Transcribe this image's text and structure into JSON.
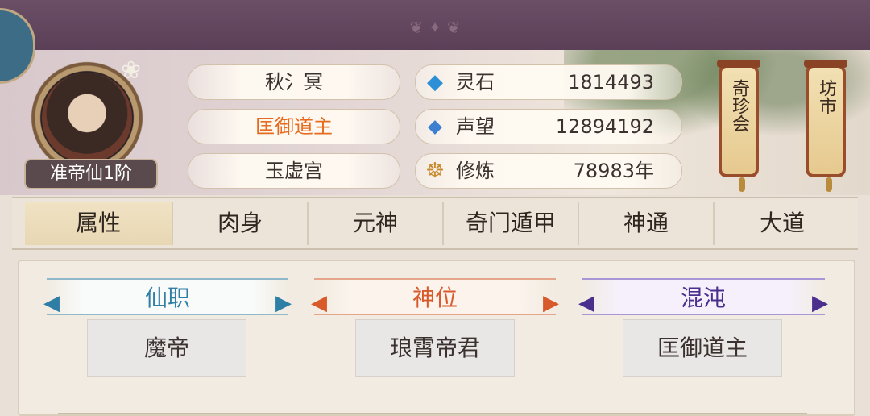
{
  "player": {
    "name": "秋氵冥",
    "title": "匡御道主",
    "sect": "玉虚宫",
    "rank": "准帝仙1阶"
  },
  "stats": [
    {
      "icon": "spirit-stone-icon",
      "label": "灵石",
      "value": "1814493"
    },
    {
      "icon": "reputation-icon",
      "label": "声望",
      "value": "12894192"
    },
    {
      "icon": "cultivation-icon",
      "label": "修炼",
      "value": "78983年"
    }
  ],
  "shops": {
    "treasure": "奇珍会",
    "market": "坊市"
  },
  "tabs": [
    "属性",
    "肉身",
    "元神",
    "奇门遁甲",
    "神通",
    "大道"
  ],
  "active_tab": "属性",
  "attributes": [
    {
      "label": "仙职",
      "value": "魔帝",
      "color": "#2f7ea6"
    },
    {
      "label": "神位",
      "value": "琅霄帝君",
      "color": "#d85a2b"
    },
    {
      "label": "混沌",
      "value": "匡御道主",
      "color": "#4a2f8d"
    }
  ]
}
